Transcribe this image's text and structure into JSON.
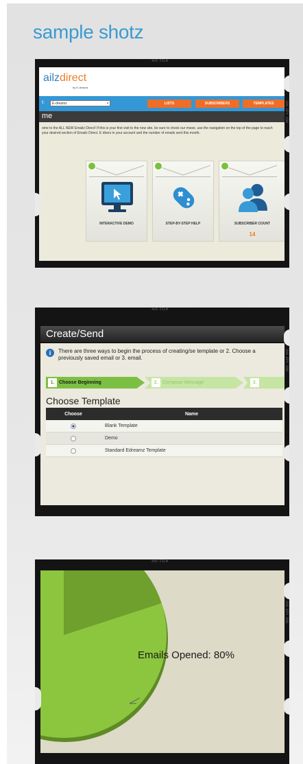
{
  "section_title": "sample shotz",
  "film": {
    "label": "4x5 FILM",
    "side": "200 EPY 590"
  },
  "shot1": {
    "logo_a": "ailz",
    "logo_b": "direct",
    "tagline": "by E-dreamz",
    "account_label": "t:",
    "account_value": "E-dreamz",
    "tabs": [
      "LISTS",
      "SUBSCRIBERS",
      "TEMPLATES"
    ],
    "page_title": "me",
    "intro": "ome to the ALL NEW Emailz Direct! If this is your first visit to the new site, be sure to check our mwse, use the navigation on the top of the page to reach your desired section of Emailz Direct. E ribers in your account and the number of emails sent this month.",
    "cards": [
      {
        "label": "INTERACTIVE DEMO",
        "icon": "monitor-icon"
      },
      {
        "label": "STEP-BY-STEP HELP",
        "icon": "gamepad-icon"
      },
      {
        "label": "SUBSCRIBER COUNT",
        "value": "14",
        "icon": "people-icon"
      }
    ],
    "colors": {
      "nav": "#3497d6",
      "tab": "#f06d26",
      "logo_blue": "#2e7fc1",
      "logo_orange": "#f07a25"
    }
  },
  "shot2": {
    "title": "Create/Send",
    "info": "There are three ways to begin the process of creating/se template or 2. Choose a previously saved email or 3. email.",
    "steps": [
      {
        "num": "1.",
        "label": "Choose Beginning",
        "active": true
      },
      {
        "num": "2.",
        "label": "Compose Message",
        "active": false
      },
      {
        "num": "3.",
        "label": "",
        "active": false
      }
    ],
    "section": "Choose Template",
    "columns": [
      "Choose",
      "Name"
    ],
    "rows": [
      {
        "selected": true,
        "name": "Blank Template"
      },
      {
        "selected": false,
        "name": "Demo"
      },
      {
        "selected": false,
        "name": "Standard Edreamz Template"
      }
    ],
    "colors": {
      "step_active": "#7cc043",
      "step_inactive": "#c6e5a4"
    }
  },
  "shot3": {
    "label": "Emails Opened: 80%",
    "chart_data": {
      "type": "pie",
      "categories": [
        "Emails Opened"
      ],
      "values": [
        80
      ],
      "colors": [
        "#8cc63e"
      ]
    }
  }
}
